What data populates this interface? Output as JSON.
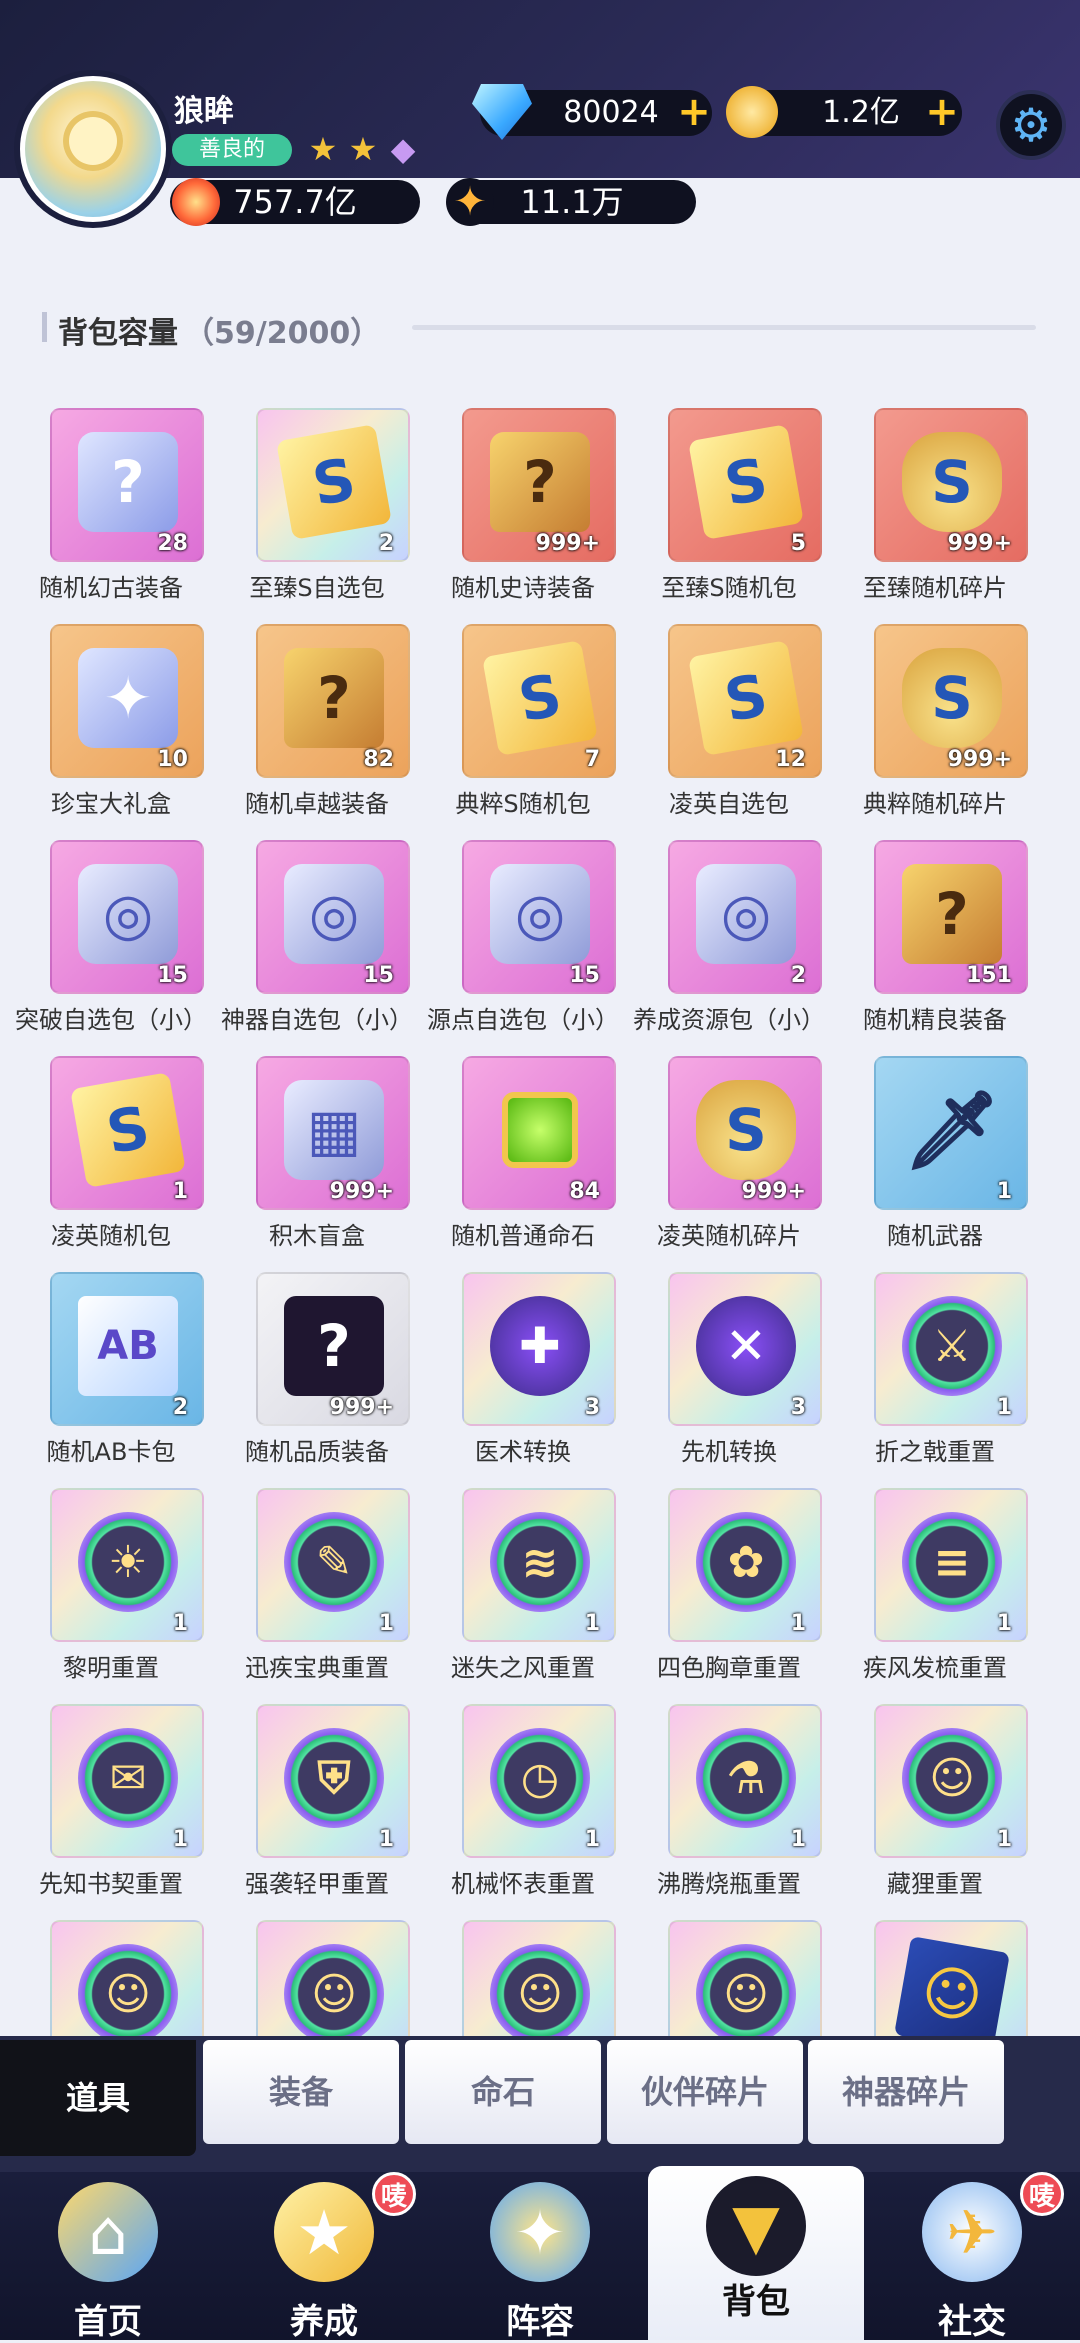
{
  "player": {
    "name": "狼眸",
    "alignment": "善良的",
    "power": "757.7亿",
    "fame": "11.1万"
  },
  "currencies": {
    "gems": "80024",
    "coins": "1.2亿"
  },
  "icons": {
    "flame": "flame-icon",
    "sparkle": "sparkle-icon",
    "gem": "gem-icon",
    "coin": "coin-icon",
    "plus": "+",
    "settings": "⚙",
    "star": "★",
    "diamond": "◆"
  },
  "inventory": {
    "title": "背包容量",
    "count": "（59/2000）",
    "items": [
      {
        "name": "随机幻古装备",
        "qty": "28",
        "art": "gift",
        "glyph": "?",
        "tile": "pink"
      },
      {
        "name": "至臻S自选包",
        "qty": "2",
        "art": "ticket",
        "glyph": "S",
        "tile": "rainbow"
      },
      {
        "name": "随机史诗装备",
        "qty": "999+",
        "art": "chest",
        "glyph": "?",
        "tile": "red"
      },
      {
        "name": "至臻S随机包",
        "qty": "5",
        "art": "ticket",
        "glyph": "S",
        "tile": "red"
      },
      {
        "name": "至臻随机碎片",
        "qty": "999+",
        "art": "bag",
        "glyph": "S",
        "tile": "red"
      },
      {
        "name": "珍宝大礼盒",
        "qty": "10",
        "art": "gift",
        "glyph": "✦",
        "tile": "orange"
      },
      {
        "name": "随机卓越装备",
        "qty": "82",
        "art": "chest",
        "glyph": "?",
        "tile": "orange"
      },
      {
        "name": "典粹S随机包",
        "qty": "7",
        "art": "ticket",
        "glyph": "S",
        "tile": "orange"
      },
      {
        "name": "凌英自选包",
        "qty": "12",
        "art": "ticket",
        "glyph": "S",
        "tile": "orange"
      },
      {
        "name": "典粹随机碎片",
        "qty": "999+",
        "art": "bag",
        "glyph": "S",
        "tile": "orange"
      },
      {
        "name": "突破自选包（小）",
        "qty": "15",
        "art": "box",
        "glyph": "◎",
        "tile": "pink"
      },
      {
        "name": "神器自选包（小）",
        "qty": "15",
        "art": "box",
        "glyph": "◎",
        "tile": "pink"
      },
      {
        "name": "源点自选包（小）",
        "qty": "15",
        "art": "box",
        "glyph": "◎",
        "tile": "pink"
      },
      {
        "name": "养成资源包（小）",
        "qty": "2",
        "art": "box",
        "glyph": "◎",
        "tile": "pink"
      },
      {
        "name": "随机精良装备",
        "qty": "151",
        "art": "chest",
        "glyph": "?",
        "tile": "pink"
      },
      {
        "name": "凌英随机包",
        "qty": "1",
        "art": "ticket",
        "glyph": "S",
        "tile": "pink"
      },
      {
        "name": "积木盲盒",
        "qty": "999+",
        "art": "box",
        "glyph": "▦",
        "tile": "pink"
      },
      {
        "name": "随机普通命石",
        "qty": "84",
        "art": "gem",
        "glyph": "",
        "tile": "pink"
      },
      {
        "name": "凌英随机碎片",
        "qty": "999+",
        "art": "bag",
        "glyph": "S",
        "tile": "pink"
      },
      {
        "name": "随机武器",
        "qty": "1",
        "art": "sword",
        "glyph": "🗡",
        "tile": "blue"
      },
      {
        "name": "随机AB卡包",
        "qty": "2",
        "art": "cards",
        "glyph": "AB",
        "tile": "blue"
      },
      {
        "name": "随机品质装备",
        "qty": "999+",
        "art": "mystery",
        "glyph": "?",
        "tile": "silver"
      },
      {
        "name": "医术转换",
        "qty": "3",
        "art": "swap",
        "glyph": "✚",
        "tile": "rainbow"
      },
      {
        "name": "先机转换",
        "qty": "3",
        "art": "swap",
        "glyph": "✕",
        "tile": "rainbow"
      },
      {
        "name": "折之戟重置",
        "qty": "1",
        "art": "reset",
        "glyph": "⚔",
        "tile": "rainbow"
      },
      {
        "name": "黎明重置",
        "qty": "1",
        "art": "reset",
        "glyph": "☀",
        "tile": "rainbow"
      },
      {
        "name": "迅疾宝典重置",
        "qty": "1",
        "art": "reset",
        "glyph": "✎",
        "tile": "rainbow"
      },
      {
        "name": "迷失之风重置",
        "qty": "1",
        "art": "reset",
        "glyph": "≋",
        "tile": "rainbow"
      },
      {
        "name": "四色胸章重置",
        "qty": "1",
        "art": "reset",
        "glyph": "✿",
        "tile": "rainbow"
      },
      {
        "name": "疾风发梳重置",
        "qty": "1",
        "art": "reset",
        "glyph": "≡",
        "tile": "rainbow"
      },
      {
        "name": "先知书契重置",
        "qty": "1",
        "art": "reset",
        "glyph": "✉",
        "tile": "rainbow"
      },
      {
        "name": "强袭轻甲重置",
        "qty": "1",
        "art": "reset",
        "glyph": "⛨",
        "tile": "rainbow"
      },
      {
        "name": "机械怀表重置",
        "qty": "1",
        "art": "reset",
        "glyph": "◷",
        "tile": "rainbow"
      },
      {
        "name": "沸腾烧瓶重置",
        "qty": "1",
        "art": "reset",
        "glyph": "⚗",
        "tile": "rainbow"
      },
      {
        "name": "藏狸重置",
        "qty": "1",
        "art": "reset",
        "glyph": "☺",
        "tile": "rainbow"
      },
      {
        "name": "",
        "qty": "",
        "art": "reset",
        "glyph": "☺",
        "tile": "rainbow"
      },
      {
        "name": "",
        "qty": "",
        "art": "reset",
        "glyph": "☺",
        "tile": "rainbow"
      },
      {
        "name": "",
        "qty": "",
        "art": "reset",
        "glyph": "☺",
        "tile": "rainbow"
      },
      {
        "name": "",
        "qty": "",
        "art": "reset",
        "glyph": "☺",
        "tile": "rainbow"
      },
      {
        "name": "",
        "qty": "",
        "art": "card-gold",
        "glyph": "☺",
        "tile": "rainbow"
      }
    ]
  },
  "subtabs": [
    "道具",
    "装备",
    "命石",
    "伙伴碎片",
    "神器碎片"
  ],
  "nav": {
    "items": [
      {
        "label": "首页",
        "icon": "⌂",
        "badge": ""
      },
      {
        "label": "养成",
        "icon": "★",
        "badge": "唛"
      },
      {
        "label": "阵容",
        "icon": "✦",
        "badge": ""
      },
      {
        "label": "背包",
        "icon": "▼",
        "badge": ""
      },
      {
        "label": "社交",
        "icon": "✈",
        "badge": "唛"
      }
    ]
  }
}
